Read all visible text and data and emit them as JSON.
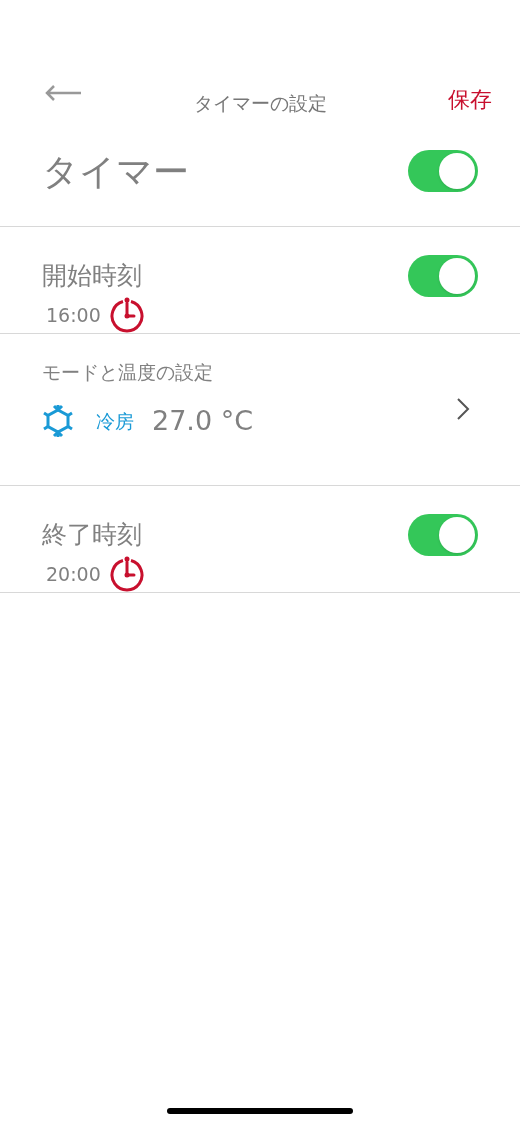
{
  "header": {
    "title": "タイマーの設定",
    "save": "保存"
  },
  "timer": {
    "label": "タイマー",
    "on": true
  },
  "start": {
    "label": "開始時刻",
    "on": true,
    "time": "16:00"
  },
  "mode": {
    "label": "モードと温度の設定",
    "mode": "冷房",
    "temperature": "27.0 °C"
  },
  "end": {
    "label": "終了時刻",
    "on": true,
    "time": "20:00"
  }
}
